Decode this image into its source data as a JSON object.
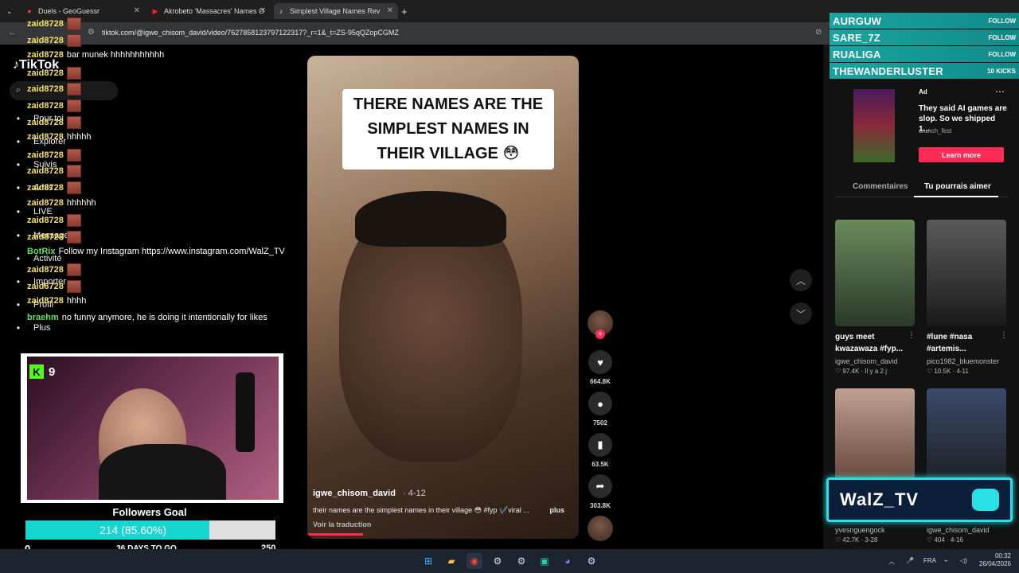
{
  "browser": {
    "tabs": [
      {
        "title": "Duels - GeoGuessr",
        "icon": "map-pin-icon"
      },
      {
        "title": "Akrobeto 'Massacres' Names O",
        "icon": "youtube-icon"
      },
      {
        "title": "Simplest Village Names Rev",
        "icon": "tiktok-icon"
      }
    ],
    "new_tab_label": "+",
    "url": "tiktok.com/@igwe_chisom_david/video/7627858123797122317?_r=1&_t=ZS-95qQZopCGMZ"
  },
  "tiktok_nav": {
    "logo": "TikTok",
    "items": [
      {
        "label": "Pour toi",
        "icon": "home-icon"
      },
      {
        "label": "Explorer",
        "icon": "compass-icon"
      },
      {
        "label": "Suivis",
        "icon": "following-icon"
      },
      {
        "label": "Amis",
        "icon": "friends-icon"
      },
      {
        "label": "LIVE",
        "icon": "live-icon"
      },
      {
        "label": "Messages",
        "icon": "send-icon"
      },
      {
        "label": "Activité",
        "icon": "inbox-icon"
      },
      {
        "label": "Importer",
        "icon": "upload-icon"
      },
      {
        "label": "Profil",
        "icon": "profile-icon"
      },
      {
        "label": "Plus",
        "icon": "more-icon"
      }
    ]
  },
  "chat": [
    {
      "user": "zaid8728",
      "emote": true,
      "msg": ""
    },
    {
      "user": "zaid8728",
      "emote": true,
      "msg": ""
    },
    {
      "user": "zaid8728",
      "emote": false,
      "msg": "bar munek hhhhhhhhhhh"
    },
    {
      "user": "zaid8728",
      "emote": true,
      "msg": ""
    },
    {
      "user": "zaid8728",
      "emote": true,
      "msg": ""
    },
    {
      "user": "zaid8728",
      "emote": true,
      "msg": ""
    },
    {
      "user": "zaid8728",
      "emote": true,
      "msg": ""
    },
    {
      "user": "zaid8728",
      "emote": false,
      "msg": "hhhhh"
    },
    {
      "user": "zaid8728",
      "emote": true,
      "msg": ""
    },
    {
      "user": "zaid8728",
      "emote": true,
      "msg": ""
    },
    {
      "user": "zaid8728",
      "emote": true,
      "msg": ""
    },
    {
      "user": "zaid8728",
      "emote": false,
      "msg": "hhhhhh"
    },
    {
      "user": "zaid8728",
      "emote": true,
      "msg": ""
    },
    {
      "user": "zaid8728",
      "emote": true,
      "msg": ""
    },
    {
      "user": "BotRix",
      "emote": false,
      "msg": "Follow my Instagram https://www.instagram.com/WalZ_TV",
      "bot": true
    },
    {
      "user": "zaid8728",
      "emote": true,
      "msg": ""
    },
    {
      "user": "zaid8728",
      "emote": true,
      "msg": ""
    },
    {
      "user": "zaid8728",
      "emote": false,
      "msg": "hhhh"
    },
    {
      "user": "braehm",
      "emote": false,
      "msg": "no funny anymore, he is doing it intentionally for likes",
      "bot": true
    }
  ],
  "stream": {
    "kick_viewers": "9",
    "goal_title": "Followers Goal",
    "goal_text": "214 (85.60%)",
    "goal_progress": 0.856,
    "goal_min": "0",
    "goal_max": "250",
    "goal_days": "36 DAYS TO GO",
    "brand": "WalZ_TV",
    "colors": {
      "accent": "#27e1e6",
      "goal_fill": "#17d6cf",
      "kick": "#53fc18"
    }
  },
  "video": {
    "caption": "THERE NAMES ARE THE SIMPLEST NAMES IN THEIR VILLAGE 😳",
    "author": "igwe_chisom_david",
    "date": "4-12",
    "desc": "their names are the simplest names in their village 😳 #fyp ✔️viral ...",
    "more": "plus",
    "translate": "Voir la traduction",
    "likes": "664.8K",
    "comments": "7502",
    "saves": "63.5K",
    "shares": "303.8K"
  },
  "alerts": [
    {
      "name": "AURGUW",
      "tag": "FOLLOW"
    },
    {
      "name": "SARE_7Z",
      "tag": "FOLLOW"
    },
    {
      "name": "RUALIGA",
      "tag": "FOLLOW"
    },
    {
      "name": "THEWANDERLUSTER",
      "tag": "10 KICKS"
    }
  ],
  "ad": {
    "label": "Ad",
    "text": "They said AI games are slop. So we shipped 1...",
    "sponsor": "crunch_fest",
    "button": "Learn more"
  },
  "panel_tabs": [
    "Commentaires",
    "Tu pourrais aimer"
  ],
  "recommendations": [
    {
      "title": "guys meet kwazawaza #fyp...",
      "author": "igwe_chisom_david",
      "stats": "♡ 97.4K · Il y a 2 j"
    },
    {
      "title": "#lune #nasa #artemis...",
      "author": "pico1982_bluemonster",
      "stats": "♡ 10.5K · 4-11"
    },
    {
      "title": "",
      "author": "yvesnguengock",
      "stats": "♡ 42.7K · 3-28"
    },
    {
      "title": "",
      "author": "igwe_chisom_david",
      "stats": "♡ 404 · 4-16"
    }
  ],
  "taskbar": {
    "language": "FRA",
    "time": "00:32",
    "date": "26/04/2026"
  }
}
